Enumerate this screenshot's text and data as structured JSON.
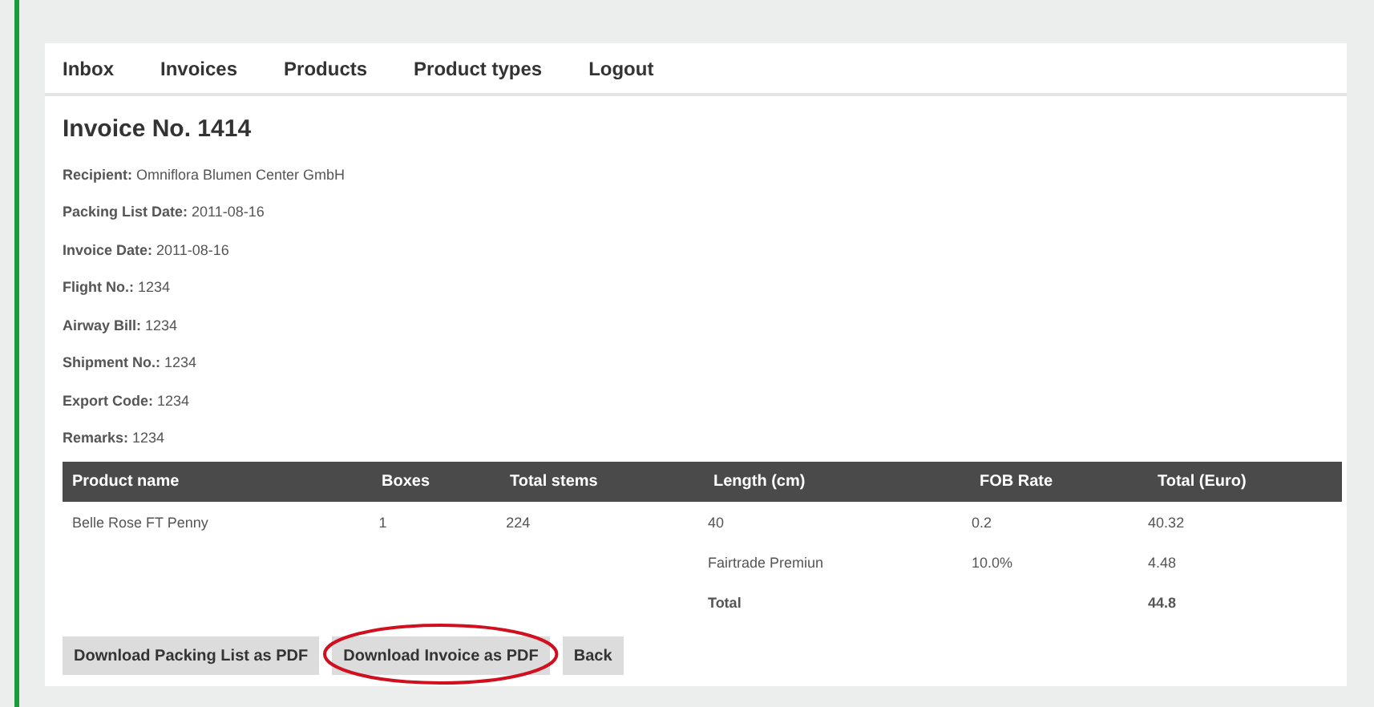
{
  "nav": [
    "Inbox",
    "Invoices",
    "Products",
    "Product types",
    "Logout"
  ],
  "title": "Invoice No. 1414",
  "fields": [
    {
      "label": "Recipient:",
      "value": "Omniflora Blumen Center GmbH"
    },
    {
      "label": "Packing List Date:",
      "value": "2011-08-16"
    },
    {
      "label": "Invoice Date:",
      "value": "2011-08-16"
    },
    {
      "label": "Flight No.:",
      "value": "1234"
    },
    {
      "label": "Airway Bill:",
      "value": "1234"
    },
    {
      "label": "Shipment No.:",
      "value": "1234"
    },
    {
      "label": "Export Code:",
      "value": "1234"
    },
    {
      "label": "Remarks:",
      "value": "1234"
    }
  ],
  "table": {
    "columns": [
      "Product name",
      "Boxes",
      "Total stems",
      "Length (cm)",
      "FOB Rate",
      "Total (Euro)"
    ],
    "rows": [
      {
        "bold": false,
        "cells": {
          "0": "Belle Rose FT Penny",
          "1": "1",
          "2": "224",
          "3": "40",
          "4": "0.2",
          "5": "40.32"
        }
      },
      {
        "bold": false,
        "cells": {
          "3": "Fairtrade Premiun",
          "4": "10.0%",
          "5": "4.48"
        }
      },
      {
        "bold": true,
        "cells": {
          "3": "Total",
          "5": "44.8"
        }
      }
    ]
  },
  "buttons": [
    {
      "label": "Download Packing List as PDF",
      "highlighted": false
    },
    {
      "label": "Download Invoice as PDF",
      "highlighted": true
    },
    {
      "label": "Back",
      "highlighted": false
    }
  ]
}
